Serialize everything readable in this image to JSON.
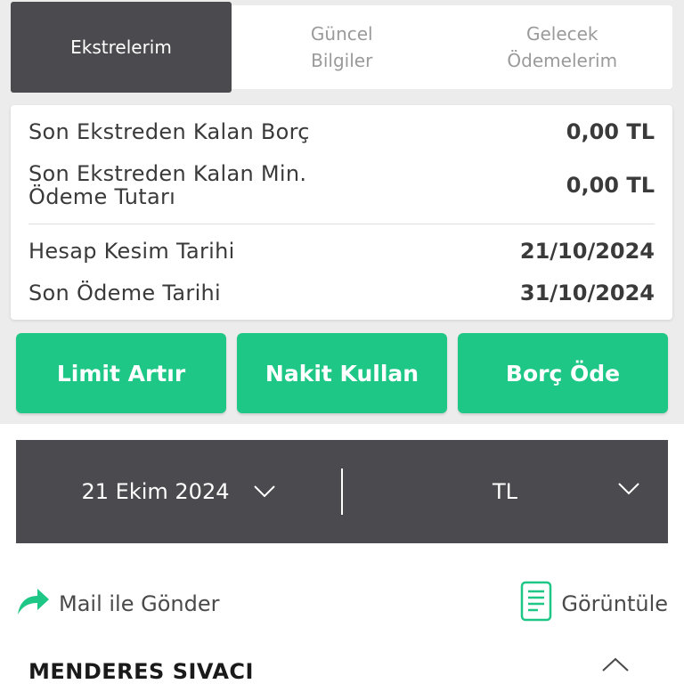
{
  "tabs": [
    {
      "label": "Ekstrelerim",
      "active": true
    },
    {
      "label": "Güncel\nBilgiler",
      "active": false
    },
    {
      "label": "Gelecek\nÖdemelerim",
      "active": false
    }
  ],
  "summary": {
    "remaining_debt_label": "Son Ekstreden Kalan Borç",
    "remaining_debt_value": "0,00 TL",
    "min_payment_label": "Son Ekstreden Kalan Min.\nÖdeme Tutarı",
    "min_payment_value": "0,00 TL",
    "cutoff_date_label": "Hesap Kesim Tarihi",
    "cutoff_date_value": "21/10/2024",
    "due_date_label": "Son Ödeme Tarihi",
    "due_date_value": "31/10/2024"
  },
  "actions": {
    "limit_increase": "Limit Artır",
    "use_cash": "Nakit Kullan",
    "pay_debt": "Borç Öde"
  },
  "selector": {
    "statement_date": "21 Ekim 2024",
    "currency": "TL"
  },
  "links": {
    "send_by_mail": "Mail ile Gönder",
    "view": "Görüntüle"
  },
  "owner": {
    "name": "MENDERES SIVACI"
  },
  "colors": {
    "accent_green": "#1fc787",
    "dark_panel": "#4b4a4e",
    "background": "#ececec"
  }
}
